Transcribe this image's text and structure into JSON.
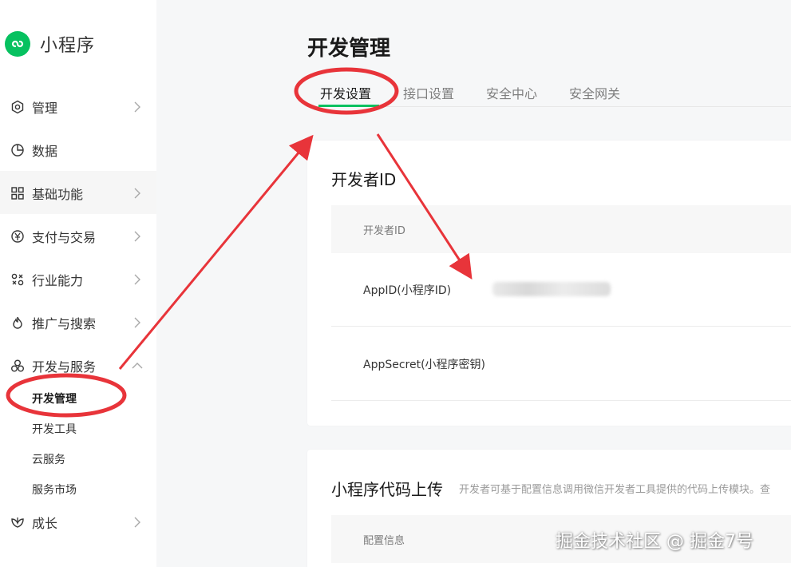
{
  "brand": {
    "title": "小程序",
    "icon": "mini-program-logo-icon",
    "color": "#07c160"
  },
  "sidebar": {
    "items": [
      {
        "label": "管理",
        "icon": "settings-icon"
      },
      {
        "label": "数据",
        "icon": "pie-chart-icon"
      },
      {
        "label": "基础功能",
        "icon": "grid-icon"
      },
      {
        "label": "支付与交易",
        "icon": "yen-icon"
      },
      {
        "label": "行业能力",
        "icon": "industry-icon"
      },
      {
        "label": "推广与搜索",
        "icon": "flame-icon"
      },
      {
        "label": "开发与服务",
        "icon": "dev-icon"
      },
      {
        "label": "成长",
        "icon": "growth-icon"
      }
    ],
    "sub_items": [
      "开发管理",
      "开发工具",
      "云服务",
      "服务市场"
    ]
  },
  "page": {
    "title": "开发管理",
    "tabs": [
      "开发设置",
      "接口设置",
      "安全中心",
      "安全网关"
    ],
    "active_tab_color": "#07c160"
  },
  "developer_card": {
    "title": "开发者ID",
    "column_header": "开发者ID",
    "rows": [
      "AppID(小程序ID)",
      "AppSecret(小程序密钥)"
    ]
  },
  "upload_card": {
    "title": "小程序代码上传",
    "description": "开发者可基于配置信息调用微信开发者工具提供的代码上传模块。查",
    "column_header": "配置信息"
  },
  "annotation_color": "#e8343a",
  "watermark": "掘金技术社区 @ 掘金7号"
}
